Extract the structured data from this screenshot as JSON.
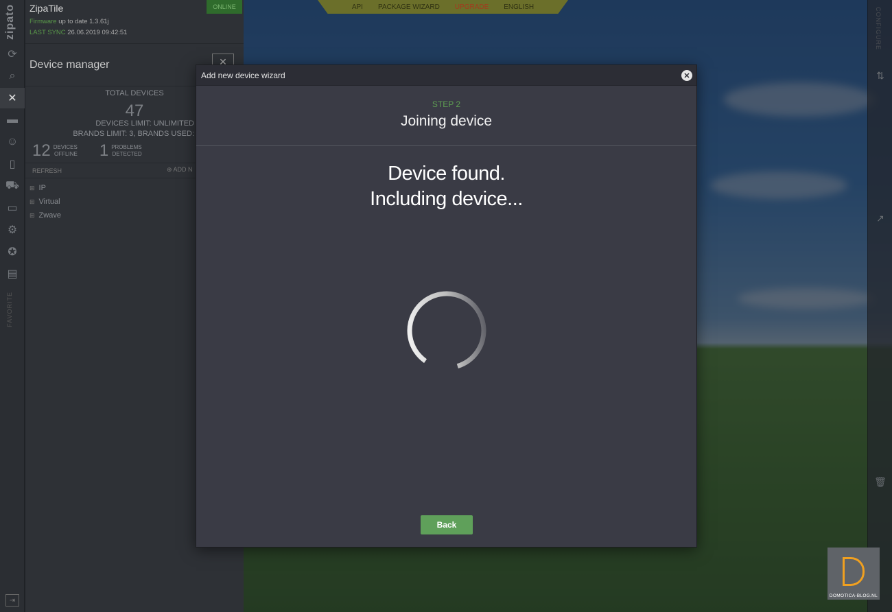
{
  "rail": {
    "logo": "zipato",
    "favorite": "FAVORITE"
  },
  "panel": {
    "title": "ZipaTile",
    "status": "ONLINE",
    "firmware_label": "Firmware",
    "firmware_text": "up to date 1.3.61j",
    "sync_label": "LAST SYNC",
    "sync_time": "26.06.2019 09:42:51",
    "manager_title": "Device manager",
    "total_label": "TOTAL DEVICES",
    "total_count": "47",
    "devices_limit": "DEVICES LIMIT: UNLIMITED",
    "brands_limit": "BRANDS LIMIT: 3, BRANDS USED:",
    "offline_count": "12",
    "offline_label_1": "DEVICES",
    "offline_label_2": "OFFLINE",
    "problems_count": "1",
    "problems_label_1": "PROBLEMS",
    "problems_label_2": "DETECTED",
    "refresh": "REFRESH",
    "add": "ADD N",
    "tree": [
      {
        "label": "IP"
      },
      {
        "label": "Virtual"
      },
      {
        "label": "Zwave"
      }
    ]
  },
  "topnav": {
    "api": "API",
    "package_wizard": "PACKAGE WIZARD",
    "upgrade": "UPGRADE",
    "language": "ENGLISH"
  },
  "right_rail": {
    "label": "CONFIGURE"
  },
  "modal": {
    "title": "Add new device wizard",
    "step": "STEP 2",
    "heading": "Joining device",
    "message_1": "Device found.",
    "message_2": "Including device...",
    "back_label": "Back"
  },
  "watermark": {
    "text": "DOMOTICA-BLOG.NL"
  },
  "colors": {
    "accent_green": "#5fa05a",
    "upgrade_red": "#a33a1e",
    "modal_bg": "#3a3b45"
  },
  "icons": {
    "refresh": "refresh-icon",
    "search": "search-icon",
    "devices": "devices-icon",
    "scenes": "scenes-icon",
    "users": "users-icon",
    "settings": "gear-icon",
    "close": "close-icon"
  }
}
